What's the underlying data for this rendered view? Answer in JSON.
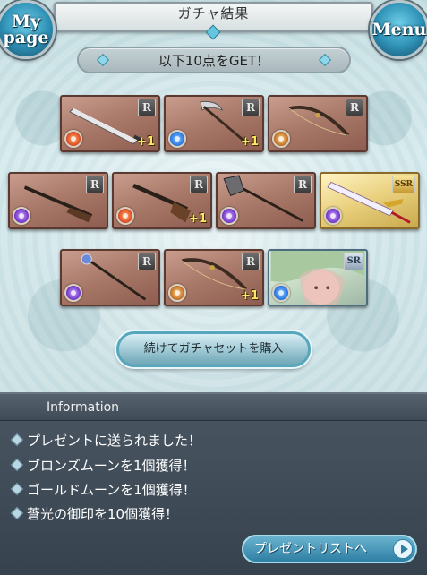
{
  "header": {
    "title": "ガチャ結果",
    "mypage_label": "My\npage",
    "menu_label": "Menu"
  },
  "banner": {
    "text": "以下10点をGET！"
  },
  "colors": {
    "fire": "#e2542a",
    "water": "#2f7ee8",
    "earth": "#c87a2c",
    "dark": "#7b3fd0",
    "wind": "#3fb35a"
  },
  "items": [
    {
      "name": "sword",
      "rarity": "R",
      "element": "fire",
      "bonus": "+1",
      "icon": "sword-icon"
    },
    {
      "name": "scythe",
      "rarity": "R",
      "element": "water",
      "bonus": "+1",
      "icon": "scythe-icon"
    },
    {
      "name": "bow",
      "rarity": "R",
      "element": "earth",
      "bonus": "",
      "icon": "bow-icon"
    },
    {
      "name": "rifle",
      "rarity": "R",
      "element": "dark",
      "bonus": "",
      "icon": "rifle-icon"
    },
    {
      "name": "gun",
      "rarity": "R",
      "element": "fire",
      "bonus": "+1",
      "icon": "gun-icon"
    },
    {
      "name": "axe",
      "rarity": "R",
      "element": "dark",
      "bonus": "",
      "icon": "axe-icon"
    },
    {
      "name": "ssr-sword",
      "rarity": "SSR",
      "element": "dark",
      "bonus": "",
      "icon": "sword-icon"
    },
    {
      "name": "staff",
      "rarity": "R",
      "element": "dark",
      "bonus": "",
      "icon": "staff-icon"
    },
    {
      "name": "bow-2",
      "rarity": "R",
      "element": "earth",
      "bonus": "+1",
      "icon": "bow-icon"
    },
    {
      "name": "sr-character",
      "rarity": "SR",
      "element": "water",
      "bonus": "",
      "icon": "character-portrait-icon"
    }
  ],
  "cta": {
    "label": "続けてガチャセットを購入"
  },
  "info": {
    "title": "Information",
    "lines": [
      "プレゼントに送られました！",
      "ブロンズムーンを1個獲得！",
      "ゴールドムーンを1個獲得！",
      "蒼光の御印を10個獲得！"
    ],
    "present_button": "プレゼントリストへ"
  }
}
